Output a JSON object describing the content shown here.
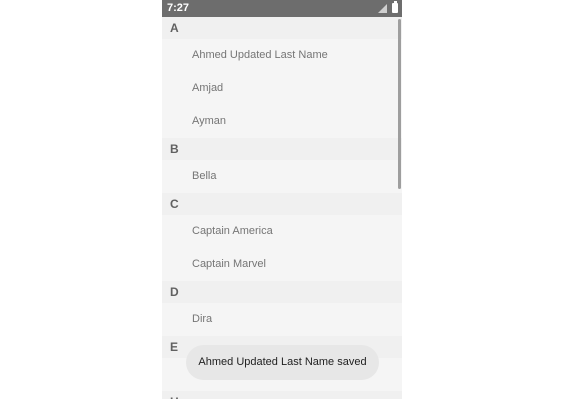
{
  "status_bar": {
    "time": "7:27",
    "signal_icon": "signal-icon",
    "battery_icon": "battery-icon"
  },
  "sections": [
    {
      "letter": "A",
      "items": [
        "Ahmed Updated Last Name",
        "Amjad",
        "Ayman"
      ]
    },
    {
      "letter": "B",
      "items": [
        "Bella"
      ]
    },
    {
      "letter": "C",
      "items": [
        "Captain America",
        "Captain Marvel"
      ]
    },
    {
      "letter": "D",
      "items": [
        "Dira"
      ]
    },
    {
      "letter": "E",
      "items": [
        ""
      ]
    },
    {
      "letter": "H",
      "items": []
    }
  ],
  "toast": {
    "message": "Ahmed Updated Last Name saved"
  },
  "colors": {
    "status_bar": "#6d6d6d",
    "background": "#f5f5f5",
    "section_header_bg": "#f0f0f0",
    "toast_bg": "#e7e7e7"
  }
}
